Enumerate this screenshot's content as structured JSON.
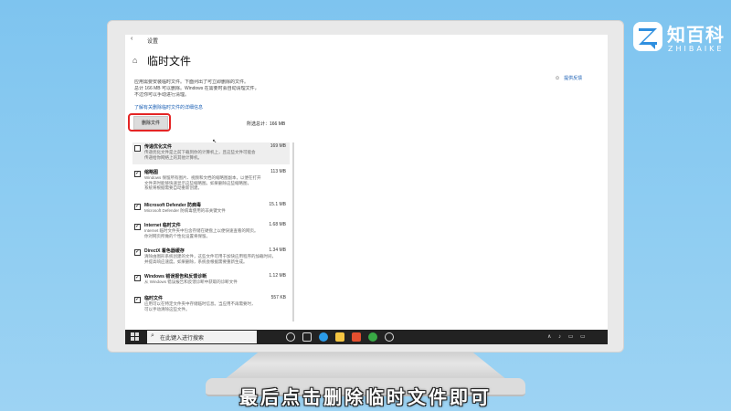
{
  "logo": {
    "title": "知百科",
    "subtitle": "ZHIBAIKE"
  },
  "topbar": {
    "back_glyph": "‹",
    "label": "设置"
  },
  "page": {
    "home_glyph": "⌂",
    "title": "临时文件",
    "desc_lines": [
      "应用需要安装临时文件。下面列出了可立即删除的文件。",
      "总计 166 MB 可以删除。Windows 在需要时会自动清理文件，",
      "不过你可以手动进行清理。"
    ],
    "help_link": "了解有关删除临时文件的详细信息",
    "feedback_link": "提供反馈"
  },
  "actions": {
    "delete_label": "删除文件",
    "total_label": "所选总计：166 MB"
  },
  "items": [
    {
      "name": "传递优化文件",
      "size": "169 MB",
      "checked": false,
      "desc": [
        "传递优化文件是之前下载到你的计算机上，且这些文件可能会",
        "传递给你网络上的其他计算机。"
      ]
    },
    {
      "name": "缩略图",
      "size": "113 MB",
      "checked": true,
      "desc": [
        "Windows 保留所有图片、视频和文档的缩略图副本，以便在打开",
        "文件夹时能够快速显示这些缩略图。如果删除这些缩略图，",
        "系统将根据需要自动重新创建。"
      ]
    },
    {
      "name": "Microsoft Defender 防病毒",
      "size": "15.1 MB",
      "checked": true,
      "desc": [
        "Microsoft Defender 防病毒使用的非关键文件"
      ]
    },
    {
      "name": "Internet 临时文件",
      "size": "1.68 MB",
      "checked": true,
      "desc": [
        "Internet 临时文件夹中包含存储在硬盘上以便快速查看的网页。",
        "你对网页所做的个性化设置将保留。"
      ]
    },
    {
      "name": "DirectX 着色器缓存",
      "size": "1.34 MB",
      "checked": true,
      "desc": [
        "清除由图形系统创建的文件，这些文件可用于加快应用程序的加载时间，",
        "并提高响应速度。如果删除，系统会根据需要重新生成。"
      ]
    },
    {
      "name": "Windows 错误报告和反馈诊断",
      "size": "1.12 MB",
      "checked": true,
      "desc": [
        "从 Windows 错误报告和反馈诊断中获取的诊断文件"
      ]
    },
    {
      "name": "临时文件",
      "size": "557 KB",
      "checked": true,
      "desc": [
        "应用可以在特定文件夹中存储临时信息。当应用不再需要时，",
        "可以手动清除这些文件。"
      ]
    }
  ],
  "taskbar": {
    "search_placeholder": "在此键入进行搜索",
    "search_glyph": "⌕",
    "sys_tray": "∧ ♪ ▭ ▭"
  },
  "caption": "最后点击删除临时文件即可"
}
